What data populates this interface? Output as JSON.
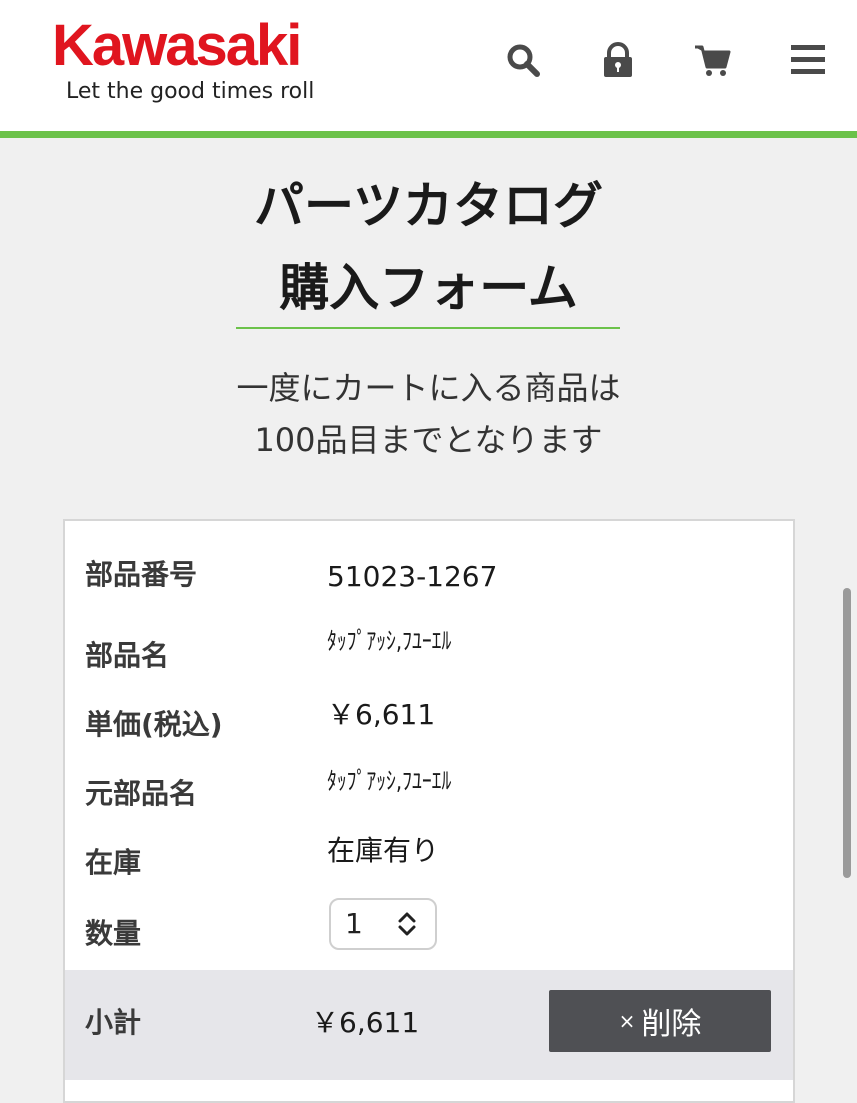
{
  "header": {
    "brand": "Kawasaki",
    "tagline": "Let the good times roll",
    "icons": [
      "search-icon",
      "lock-icon",
      "cart-icon",
      "menu-icon"
    ],
    "brand_color": "#e0151f",
    "accent_color": "#6cc24a"
  },
  "main": {
    "title_line1": "パーツカタログ",
    "title_line2": "購入フォーム",
    "notice_line1": "一度にカートに入る商品は",
    "notice_line2": "100品目までとなります"
  },
  "item": {
    "part_number_label": "部品番号",
    "part_number": "51023-1267",
    "part_name_label": "部品名",
    "part_name": "ﾀｯﾌﾟｱｯｼ,ﾌﾕｰｴﾙ",
    "unit_price_label": "単価(税込)",
    "unit_price": "￥6,611",
    "original_name_label": "元部品名",
    "original_name": "ﾀｯﾌﾟｱｯｼ,ﾌﾕｰｴﾙ",
    "stock_label": "在庫",
    "stock": "在庫有り",
    "quantity_label": "数量",
    "quantity": "1",
    "subtotal_label": "小計",
    "subtotal": "￥6,611",
    "delete_x": "×",
    "delete_label": "削除"
  }
}
